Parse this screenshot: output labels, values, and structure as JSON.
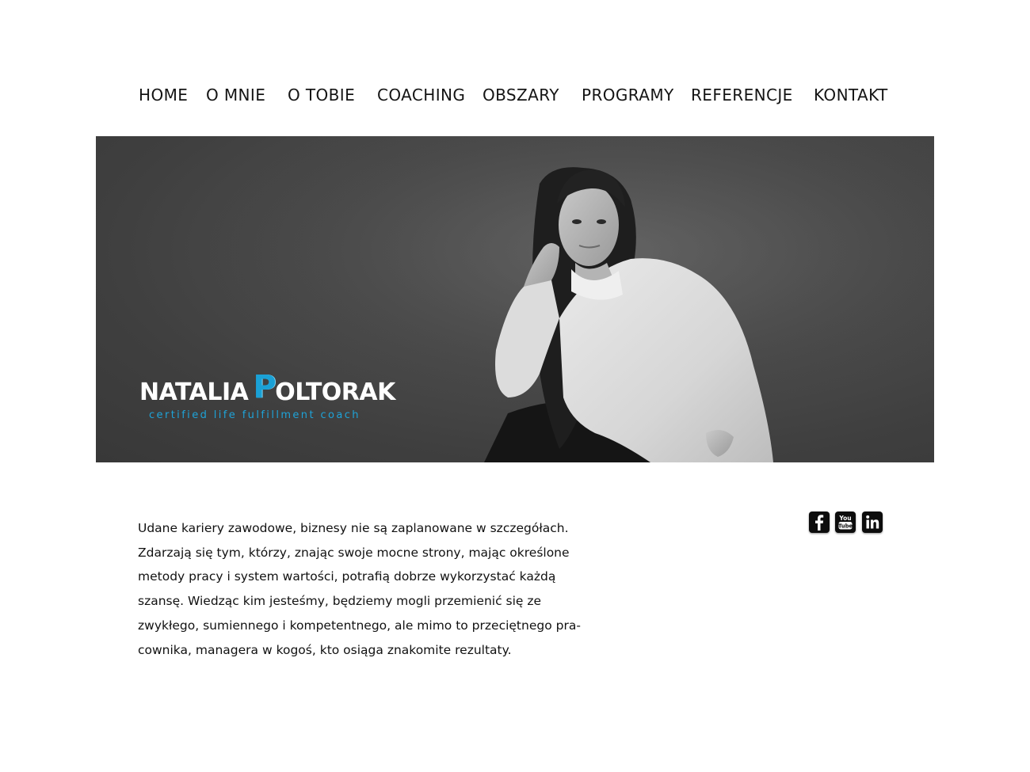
{
  "nav": {
    "items": [
      {
        "label": "HOME"
      },
      {
        "label": "O MNIE"
      },
      {
        "label": "O TOBIE"
      },
      {
        "label": "COACHING"
      },
      {
        "label": "OBSZARY"
      },
      {
        "label": "PROGRAMY"
      },
      {
        "label": "REFERENCJE"
      },
      {
        "label": "KONTAKT"
      }
    ]
  },
  "hero": {
    "brand_first": "NATALIA",
    "brand_p": "P",
    "brand_rest": "OLTORAK",
    "tagline": "certified life fulfillment coach"
  },
  "intro": {
    "lines": [
      "Udane kariery zawodowe, biznesy nie są zaplanowane w szczegółach.",
      "Zdarzają się tym, którzy, znając swoje mocne strony, mając określone",
      "metody pracy i system wartości, potrafią dobrze wykorzystać każdą",
      "szansę. Wiedząc kim jesteśmy, będziemy mogli przemienić się ze",
      "zwykłego, sumiennego i kompetentnego, ale mimo to przeciętnego pra-",
      "cownika, managera w kogoś, kto osiąga znakomite rezultaty."
    ]
  },
  "social": {
    "icons": [
      "facebook-icon",
      "youtube-icon",
      "linkedin-icon"
    ],
    "youtube_you": "You",
    "youtube_tube": "Tube"
  },
  "colors": {
    "accent": "#1aa1d6",
    "hero_bg": "#474747",
    "text": "#111111"
  }
}
